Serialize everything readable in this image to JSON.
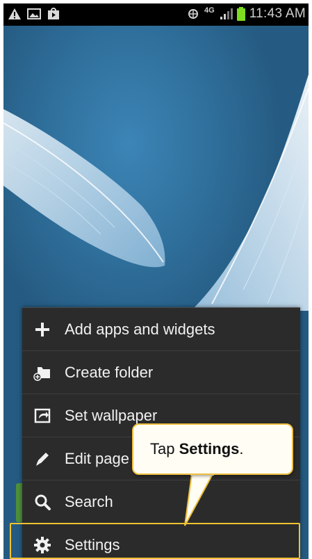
{
  "status_bar": {
    "left_icons": [
      "warning-icon",
      "image-icon",
      "media-store-icon"
    ],
    "right_icons": [
      "vibrate-icon",
      "network-4g-icon",
      "signal-icon",
      "battery-icon"
    ],
    "network_label": "4G",
    "time": "11:43 AM"
  },
  "menu": {
    "items": [
      {
        "label": "Add apps and widgets",
        "icon": "plus-icon"
      },
      {
        "label": "Create folder",
        "icon": "folder-add-icon"
      },
      {
        "label": "Set wallpaper",
        "icon": "wallpaper-icon"
      },
      {
        "label": "Edit page",
        "icon": "pencil-icon"
      },
      {
        "label": "Search",
        "icon": "search-icon"
      },
      {
        "label": "Settings",
        "icon": "gear-icon"
      }
    ]
  },
  "callout": {
    "prefix": "Tap ",
    "emphasis": "Settings",
    "suffix": "."
  },
  "colors": {
    "menu_background": "#2b2b2b",
    "highlight": "#f2c230",
    "wallpaper": "#2f6c97"
  }
}
